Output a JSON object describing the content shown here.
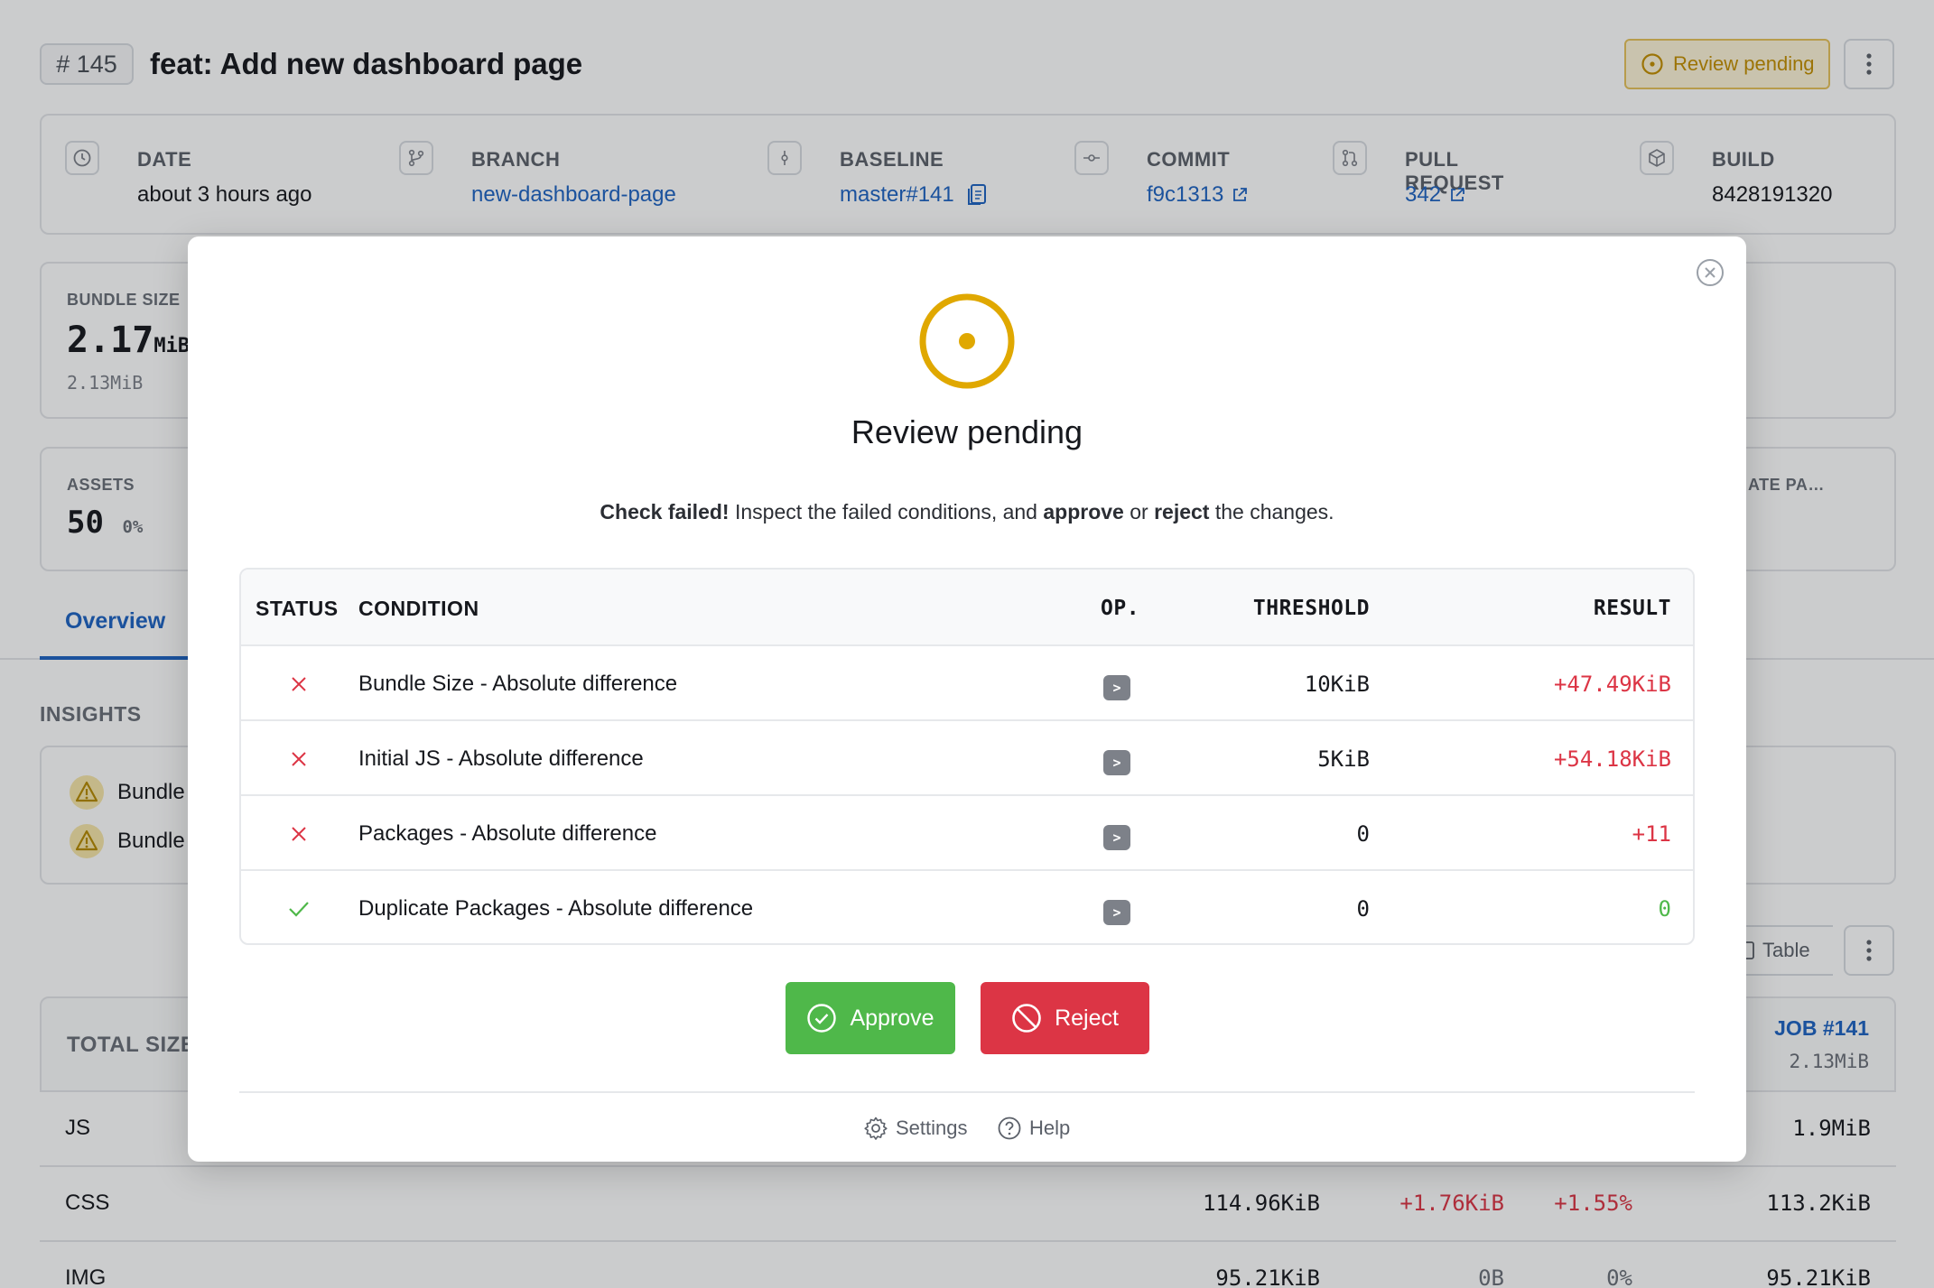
{
  "header": {
    "job_number": "# 145",
    "title": "feat: Add new dashboard page",
    "status_badge": "Review pending"
  },
  "meta": {
    "date": {
      "label": "DATE",
      "value": "about 3 hours ago"
    },
    "branch": {
      "label": "BRANCH",
      "value": "new-dashboard-page"
    },
    "baseline": {
      "label": "BASELINE",
      "value": "master#141"
    },
    "commit": {
      "label": "COMMIT",
      "value": "f9c1313"
    },
    "pull_request": {
      "label": "PULL REQUEST",
      "value": "342"
    },
    "build": {
      "label": "BUILD",
      "value": "8428191320"
    }
  },
  "summary": {
    "bundle_size": {
      "label": "BUNDLE SIZE",
      "value": "2.17",
      "unit": "MiB",
      "baseline": "2.13MiB"
    },
    "assets": {
      "label": "ASSETS",
      "value": "50",
      "delta": "0%"
    },
    "truncated_label": "ATE PA…"
  },
  "tabs": {
    "overview": "Overview"
  },
  "insights": {
    "title": "INSIGHTS",
    "items": [
      "Bundle",
      "Bundle"
    ]
  },
  "view_toggle": {
    "table": "Table"
  },
  "totals_table": {
    "header_label": "TOTAL SIZE",
    "baseline_job": "JOB #141",
    "baseline_total": "2.13MiB",
    "rows": [
      {
        "name": "JS",
        "current": "",
        "delta": "",
        "percent": "",
        "baseline": "1.9MiB"
      },
      {
        "name": "CSS",
        "current": "114.96KiB",
        "delta": "+1.76KiB",
        "percent": "+1.55%",
        "baseline": "113.2KiB"
      },
      {
        "name": "IMG",
        "current": "95.21KiB",
        "delta": "0B",
        "percent": "0%",
        "baseline": "95.21KiB"
      }
    ]
  },
  "modal": {
    "title": "Review pending",
    "message": {
      "strong1": "Check failed!",
      "text1": " Inspect the failed conditions, and ",
      "strong2": "approve",
      "text2": " or ",
      "strong3": "reject",
      "text3": " the changes."
    },
    "columns": {
      "status": "STATUS",
      "condition": "CONDITION",
      "op": "OP.",
      "threshold": "THRESHOLD",
      "result": "RESULT"
    },
    "conditions": [
      {
        "status": "failed",
        "condition": "Bundle Size - Absolute difference",
        "op": ">",
        "threshold": "10KiB",
        "result": "+47.49KiB"
      },
      {
        "status": "failed",
        "condition": "Initial JS - Absolute difference",
        "op": ">",
        "threshold": "5KiB",
        "result": "+54.18KiB"
      },
      {
        "status": "failed",
        "condition": "Packages - Absolute difference",
        "op": ">",
        "threshold": "0",
        "result": "+11"
      },
      {
        "status": "passed",
        "condition": "Duplicate Packages - Absolute difference",
        "op": ">",
        "threshold": "0",
        "result": "0"
      }
    ],
    "approve_label": "Approve",
    "reject_label": "Reject",
    "settings_label": "Settings",
    "help_label": "Help"
  },
  "colors": {
    "pending": "#e0a800",
    "danger": "#dc3545",
    "success": "#4fb84a",
    "link": "#1e63c2"
  }
}
